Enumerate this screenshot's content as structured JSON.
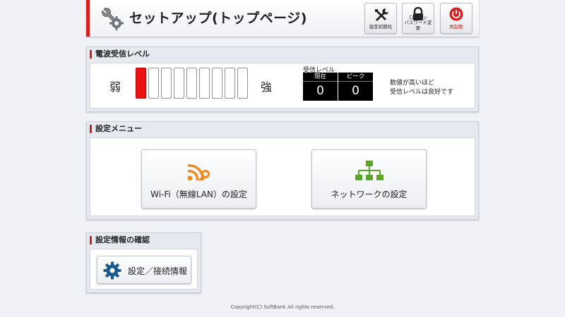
{
  "header": {
    "title": "セットアップ(トップページ)",
    "logo_icon": "wrench-gear-icon",
    "buttons": [
      {
        "label": "設定初期化",
        "icon": "tools-icon"
      },
      {
        "label": "ログイン\nパスワード変更",
        "icon": "lock-icon"
      },
      {
        "label": "再起動",
        "icon": "power-icon"
      }
    ]
  },
  "signal": {
    "heading": "電波受信レベル",
    "weak_label": "弱",
    "strong_label": "強",
    "bars_total": 9,
    "bars_active": 1,
    "level_caption": "受信レベル",
    "current_label": "現在",
    "current_value": "0",
    "peak_label": "ピーク",
    "peak_value": "0",
    "note_line1": "数値が高いほど",
    "note_line2": "受信レベルは良好です"
  },
  "settings_menu": {
    "heading": "設定メニュー",
    "wifi_label": "Wi-Fi（無線LAN）の設定",
    "wifi_icon": "wifi-key-icon",
    "network_label": "ネットワークの設定",
    "network_icon": "network-tree-icon"
  },
  "confirm": {
    "heading": "設定情報の確認",
    "button_label": "設定／接続情報",
    "button_icon": "gear-icon"
  },
  "footer": {
    "copyright": "Copyright(C) SoftBank All rights reserved."
  },
  "colors": {
    "accent_red": "#d81e1e",
    "wifi_orange": "#f08a1c",
    "network_green": "#5aa52a",
    "gear_blue": "#1a5a8c"
  }
}
